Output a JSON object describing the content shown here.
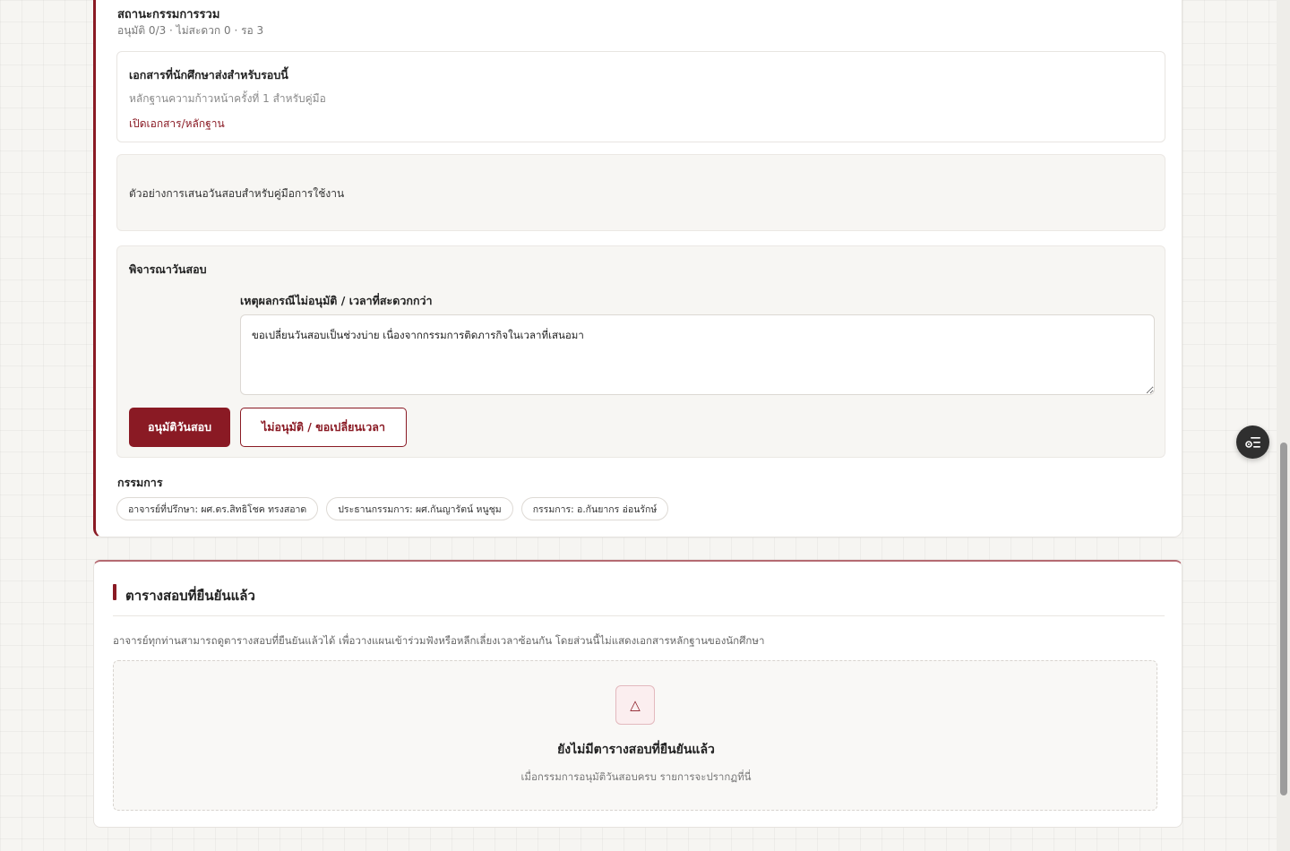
{
  "review_card": {
    "status_title": "สถานะกรรมการรวม",
    "status_summary": "อนุมัติ 0/3 · ไม่สะดวก 0 · รอ 3",
    "documents": {
      "title": "เอกสารที่นักศึกษาส่งสำหรับรอบนี้",
      "description": "หลักฐานความก้าวหน้าครั้งที่ 1 สำหรับคู่มือ",
      "open_link": "เปิดเอกสาร/หลักฐาน"
    },
    "sample_note": "ตัวอย่างการเสนอวันสอบสำหรับคู่มือการใช้งาน",
    "consideration": {
      "title": "พิจารณาวันสอบ",
      "reason_label": "เหตุผลกรณีไม่อนุมัติ / เวลาที่สะดวกกว่า",
      "reason_value": "ขอเปลี่ยนวันสอบเป็นช่วงบ่าย เนื่องจากกรรมการติดภารกิจในเวลาที่เสนอมา",
      "approve_label": "อนุมัติวันสอบ",
      "reject_label": "ไม่อนุมัติ / ขอเปลี่ยนเวลา"
    },
    "committee": {
      "title": "กรรมการ",
      "members": [
        "อาจารย์ที่ปรึกษา: ผศ.ดร.สิทธิโชค ทรงสอาด",
        "ประธานกรรมการ: ผศ.กันญารัตน์ หนูชุม",
        "กรรมการ: อ.กันยากร อ่อนรักษ์"
      ]
    }
  },
  "confirmed_schedule": {
    "title": "ตารางสอบที่ยืนยันแล้ว",
    "description": "อาจารย์ทุกท่านสามารถดูตารางสอบที่ยืนยันแล้วได้ เพื่อวางแผนเข้าร่วมฟังหรือหลีกเลี่ยงเวลาซ้อนกัน โดยส่วนนี้ไม่แสดงเอกสารหลักฐานของนักศึกษา",
    "empty_icon": "△",
    "empty_title": "ยังไม่มีตารางสอบที่ยืนยันแล้ว",
    "empty_subtitle": "เมื่อกรรมการอนุมัติวันสอบครบ รายการจะปรากฏที่นี่"
  },
  "floating_button": {
    "icon": "settings-list-icon"
  },
  "colors": {
    "accent": "#8a1a24",
    "background": "#f6f5f2"
  }
}
